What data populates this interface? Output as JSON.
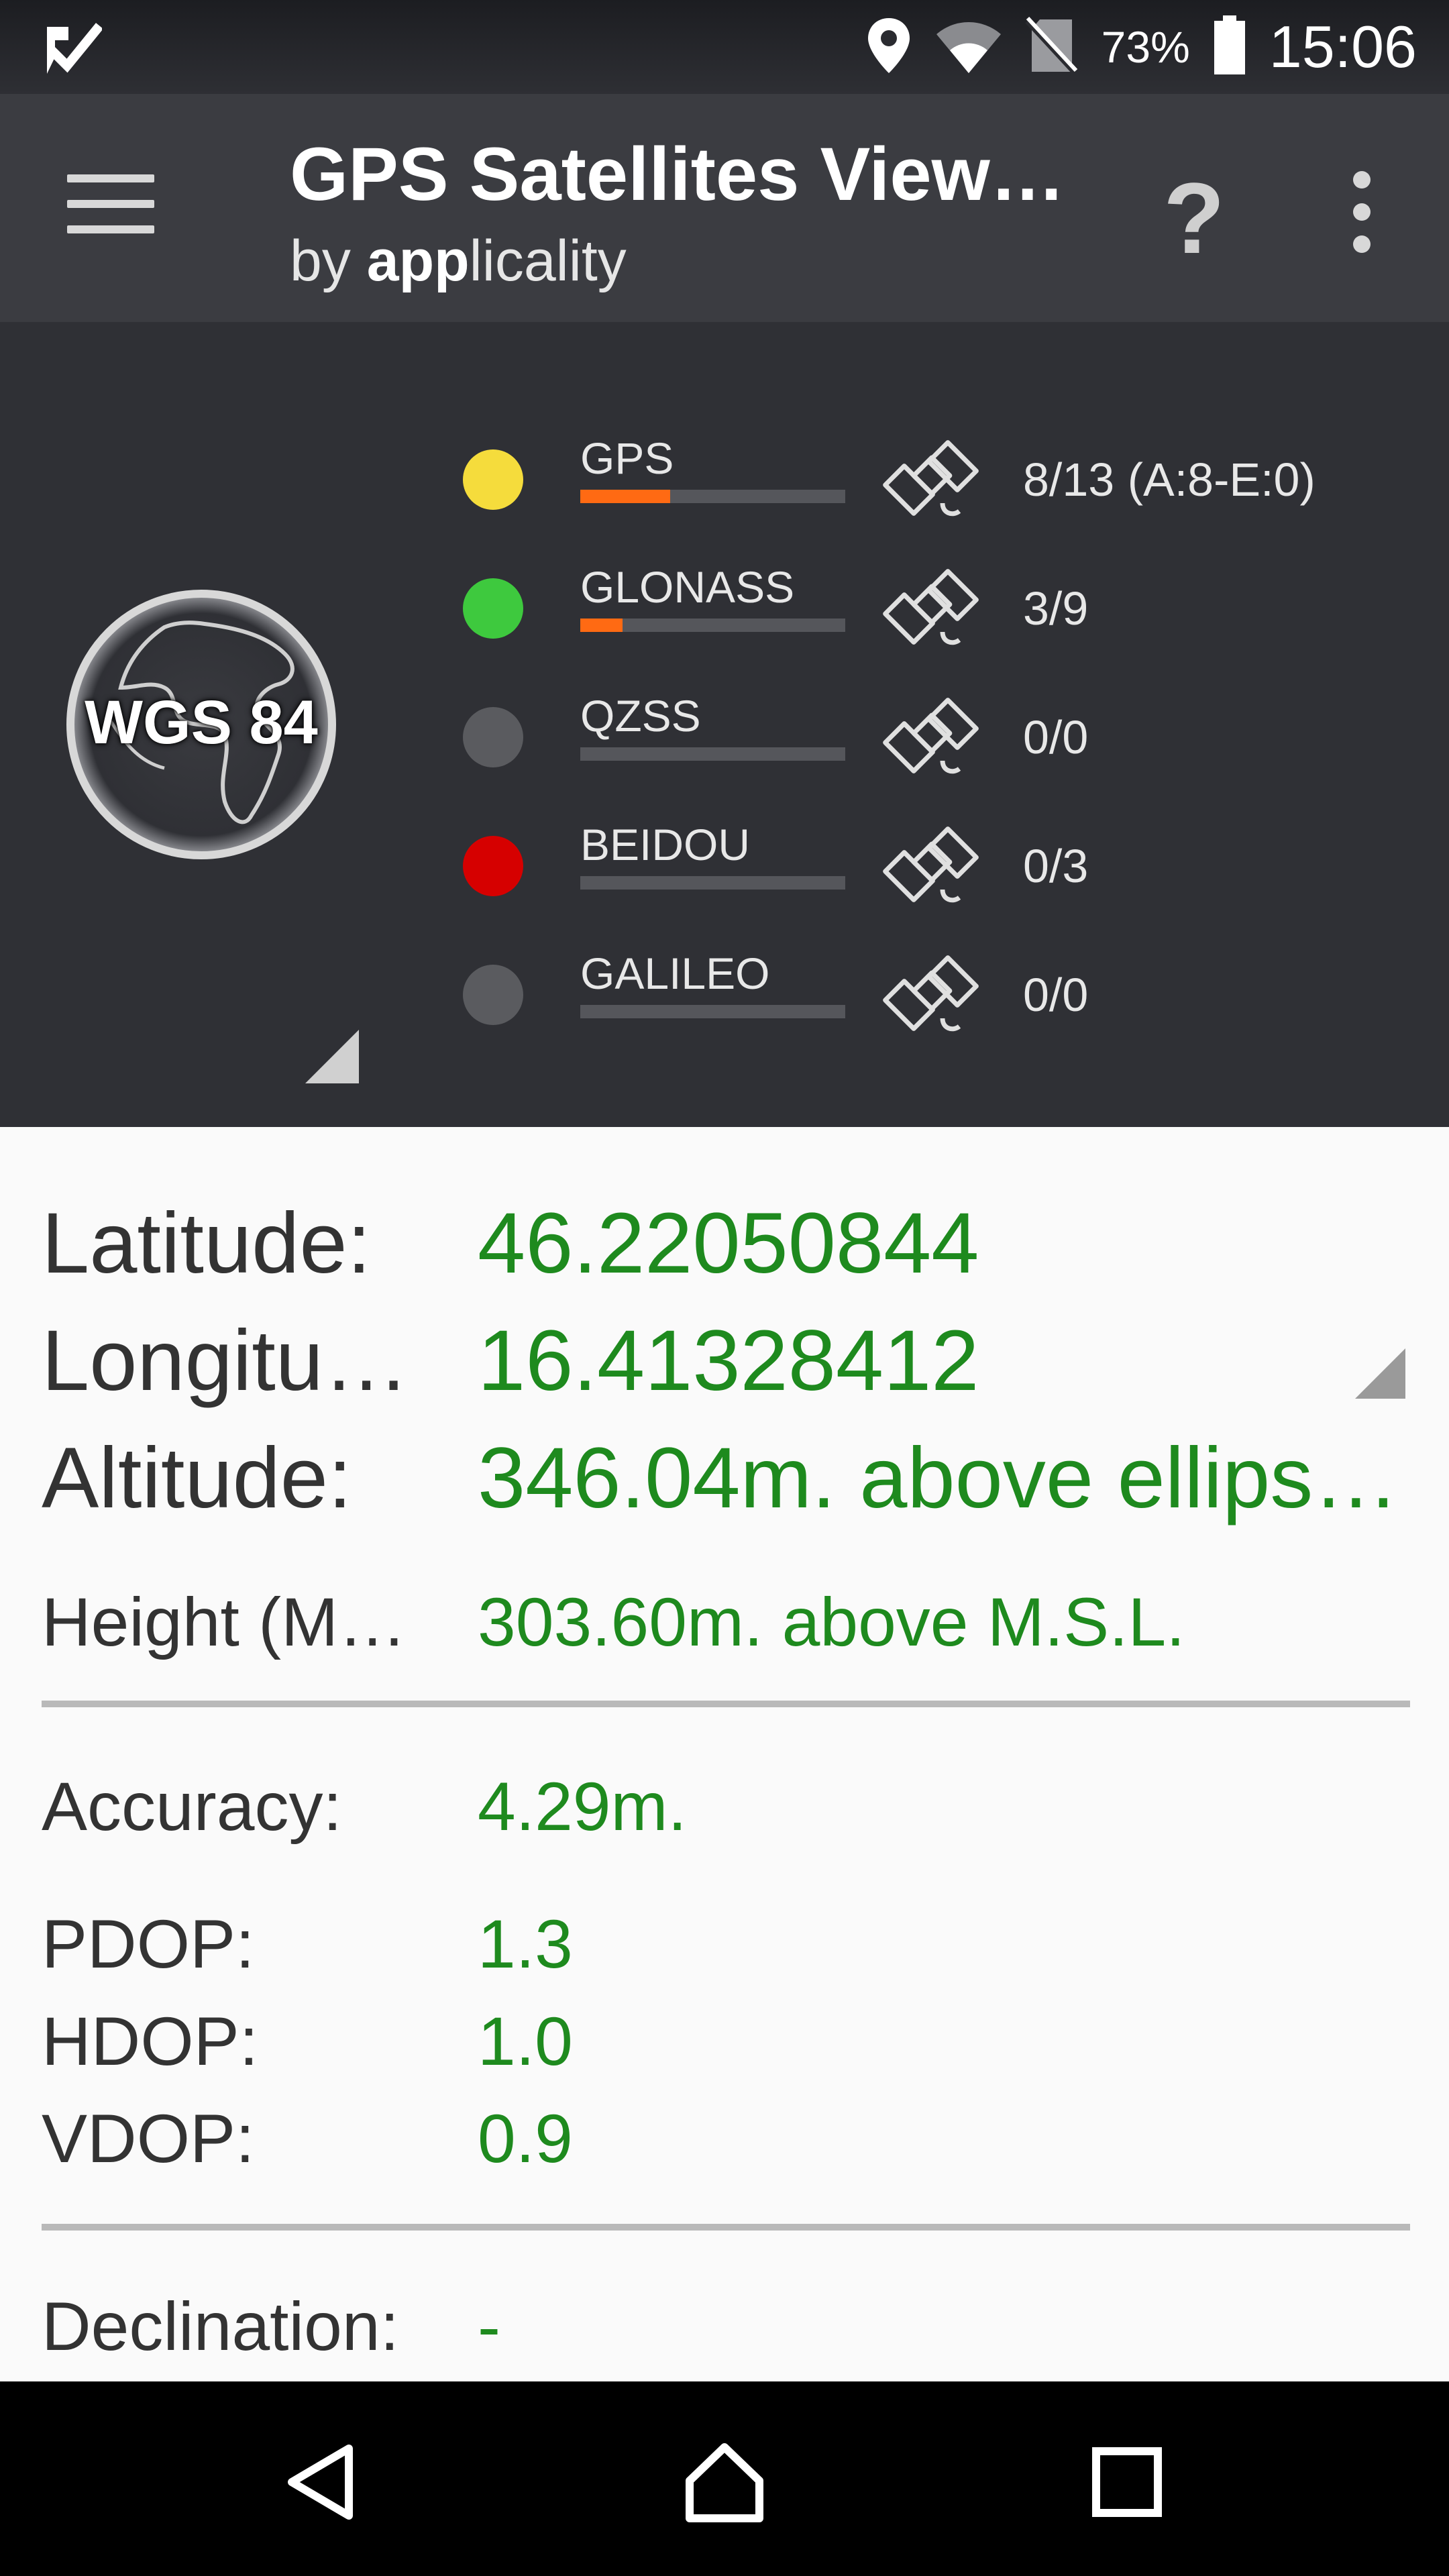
{
  "status_bar": {
    "battery_percent": "73%",
    "time": "15:06",
    "icons": [
      "check-notification-icon",
      "location-icon",
      "wifi-icon",
      "no-sim-icon",
      "battery-icon"
    ]
  },
  "app_bar": {
    "title": "GPS Satellites View…",
    "subtitle_prefix": "by ",
    "subtitle_bold": "app",
    "subtitle_rest": "licality",
    "help_label": "?"
  },
  "satellite_panel": {
    "datum_label": "WGS 84",
    "systems": [
      {
        "name": "GPS",
        "dot_color": "#f5dc3c",
        "signal_fraction": 0.34,
        "count": "8/13 (A:8-E:0)"
      },
      {
        "name": "GLONASS",
        "dot_color": "#3ec93e",
        "signal_fraction": 0.16,
        "count": "3/9"
      },
      {
        "name": "QZSS",
        "dot_color": "#5a5b5f",
        "signal_fraction": 0,
        "count": "0/0"
      },
      {
        "name": "BEIDOU",
        "dot_color": "#d60000",
        "signal_fraction": 0,
        "count": "0/3"
      },
      {
        "name": "GALILEO",
        "dot_color": "#5a5b5f",
        "signal_fraction": 0,
        "count": "0/0"
      }
    ]
  },
  "position": {
    "latitude_label": "Latitude:",
    "latitude_value": "46.22050844",
    "longitude_label": "Longitu…",
    "longitude_value": "16.41328412",
    "altitude_label": "Altitude:",
    "altitude_value": "346.04m. above ellips…",
    "height_label": "Height (M…",
    "height_value": "303.60m. above M.S.L."
  },
  "accuracy": {
    "accuracy_label": "Accuracy:",
    "accuracy_value": "4.29m.",
    "pdop_label": "PDOP:",
    "pdop_value": "1.3",
    "hdop_label": "HDOP:",
    "hdop_value": "1.0",
    "vdop_label": "VDOP:",
    "vdop_value": "0.9"
  },
  "declination": {
    "label": "Declination:",
    "value": "-"
  },
  "colors": {
    "value_green": "#1e8a1e",
    "signal_orange": "#ff6a13",
    "panel_dark": "#2f3035",
    "appbar": "#3b3c41"
  }
}
